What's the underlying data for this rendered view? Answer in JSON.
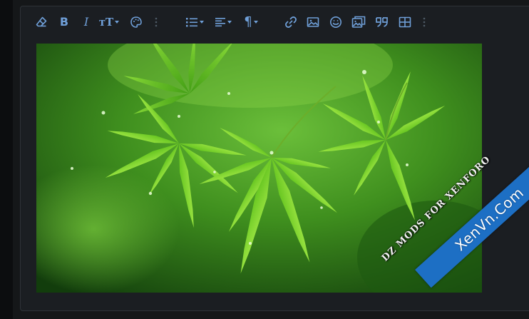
{
  "toolbar": {
    "buttons": [
      {
        "id": "eraser",
        "icon": "eraser-icon"
      },
      {
        "id": "bold",
        "label": "B"
      },
      {
        "id": "italic",
        "label": "I"
      },
      {
        "id": "text-size",
        "label": "тT"
      },
      {
        "id": "color",
        "icon": "palette-icon"
      },
      {
        "id": "more-1",
        "icon": "vertical-dots-icon"
      },
      {
        "id": "list",
        "icon": "list-icon"
      },
      {
        "id": "align",
        "icon": "align-icon"
      },
      {
        "id": "paragraph",
        "label": "¶"
      },
      {
        "id": "link",
        "icon": "link-icon"
      },
      {
        "id": "image",
        "icon": "image-icon"
      },
      {
        "id": "smilie",
        "icon": "smile-icon"
      },
      {
        "id": "media",
        "icon": "media-icon"
      },
      {
        "id": "quote",
        "icon": "quote-icon"
      },
      {
        "id": "table",
        "icon": "table-icon"
      },
      {
        "id": "more-2",
        "icon": "vertical-dots-icon"
      }
    ],
    "bold_label": "B",
    "italic_label": "I",
    "textsize_label": "тT",
    "paragraph_label": "¶",
    "icon_color": "#6f9fd8"
  },
  "content": {
    "image_subject": "green maple leaves with water droplets",
    "watermark": "DZ MODS FOR XENFORO"
  },
  "corner_ribbon": {
    "text": "XenVn.Com",
    "color": "#1d6fc4"
  }
}
